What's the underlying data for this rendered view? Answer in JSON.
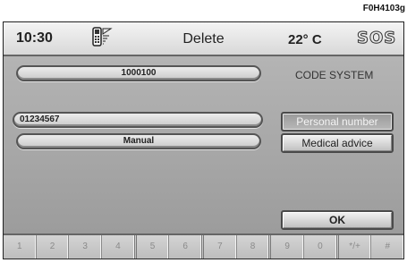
{
  "reference_code": "F0H4103g",
  "status_bar": {
    "time": "10:30",
    "title": "Delete",
    "temperature": "22° C",
    "sos_label": "SOS",
    "phone_icon": "phone-signal-icon"
  },
  "fields": {
    "code_value": "1000100",
    "code_system_label": "CODE SYSTEM",
    "number_value": "01234567",
    "mode_value": "Manual"
  },
  "buttons": {
    "personal_number": "Personal number",
    "medical_advice": "Medical advice",
    "ok": "OK"
  },
  "keypad": [
    "1",
    "2",
    "3",
    "4",
    "5",
    "6",
    "7",
    "8",
    "9",
    "0",
    "*/+",
    "#"
  ]
}
